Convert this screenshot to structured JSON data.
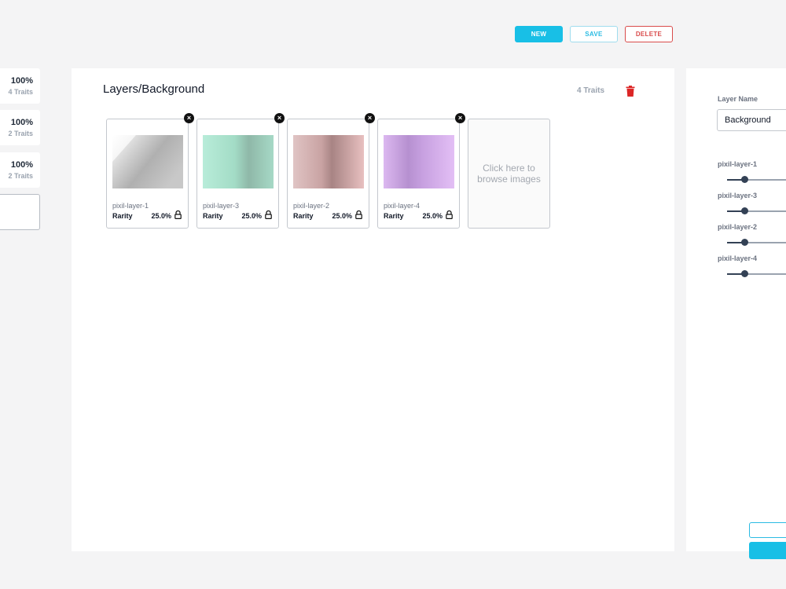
{
  "toolbar": {
    "new_label": "NEW",
    "save_label": "SAVE",
    "delete_label": "DELETE"
  },
  "layers_list": [
    {
      "percent": "100%",
      "traits": "4 Traits"
    },
    {
      "percent": "100%",
      "traits": "2 Traits"
    },
    {
      "percent": "100%",
      "traits": "2 Traits"
    }
  ],
  "main": {
    "title": "Layers/Background",
    "trait_count": "4 Traits",
    "browse_text": "Click here to browse images",
    "traits": [
      {
        "name": "pixil-layer-1",
        "rarity_label": "Rarity",
        "rarity": "25.0%",
        "color": "#b5b5b5"
      },
      {
        "name": "pixil-layer-3",
        "rarity_label": "Rarity",
        "rarity": "25.0%",
        "color": "#a8e0ca"
      },
      {
        "name": "pixil-layer-2",
        "rarity_label": "Rarity",
        "rarity": "25.0%",
        "color": "#d9b6b6"
      },
      {
        "name": "pixil-layer-4",
        "rarity_label": "Rarity",
        "rarity": "25.0%",
        "color": "#cfa6e6"
      }
    ]
  },
  "right_panel": {
    "layer_name_label": "Layer Name",
    "layer_name_value": "Background",
    "sliders": [
      {
        "label": "pixil-layer-1",
        "value": 0.22
      },
      {
        "label": "pixil-layer-3",
        "value": 0.22
      },
      {
        "label": "pixil-layer-2",
        "value": 0.22
      },
      {
        "label": "pixil-layer-4",
        "value": 0.22
      }
    ]
  },
  "colors": {
    "accent": "#18bfe6",
    "danger": "#d94b4b"
  }
}
